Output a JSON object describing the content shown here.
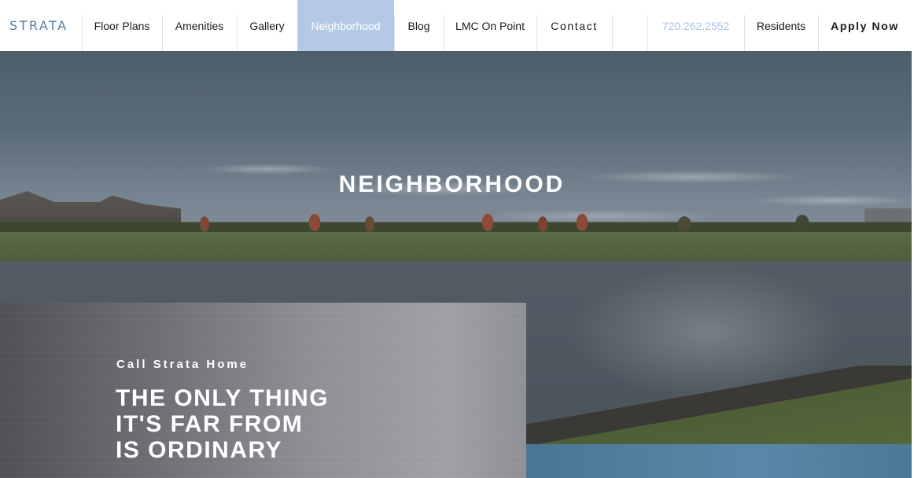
{
  "brand": {
    "logo_text": "STRATA",
    "accent": "#4f7ea6",
    "active_bg": "#b3c9e6",
    "phone_color": "#a8c2df"
  },
  "nav": {
    "items": [
      {
        "label": "Floor Plans"
      },
      {
        "label": "Amenities"
      },
      {
        "label": "Gallery"
      },
      {
        "label": "Neighborhood",
        "active": true
      },
      {
        "label": "Blog"
      },
      {
        "label": "LMC On Point"
      },
      {
        "label": "Contact"
      },
      {
        "label": ""
      },
      {
        "label": "720.262.2552"
      },
      {
        "label": "Residents"
      },
      {
        "label": "Apply Now"
      }
    ]
  },
  "hero": {
    "title": "NEIGHBORHOOD"
  },
  "panel": {
    "kicker": "Call Strata Home",
    "headline": [
      "THE ONLY THING",
      "IT'S FAR FROM",
      "IS ORDINARY"
    ]
  }
}
